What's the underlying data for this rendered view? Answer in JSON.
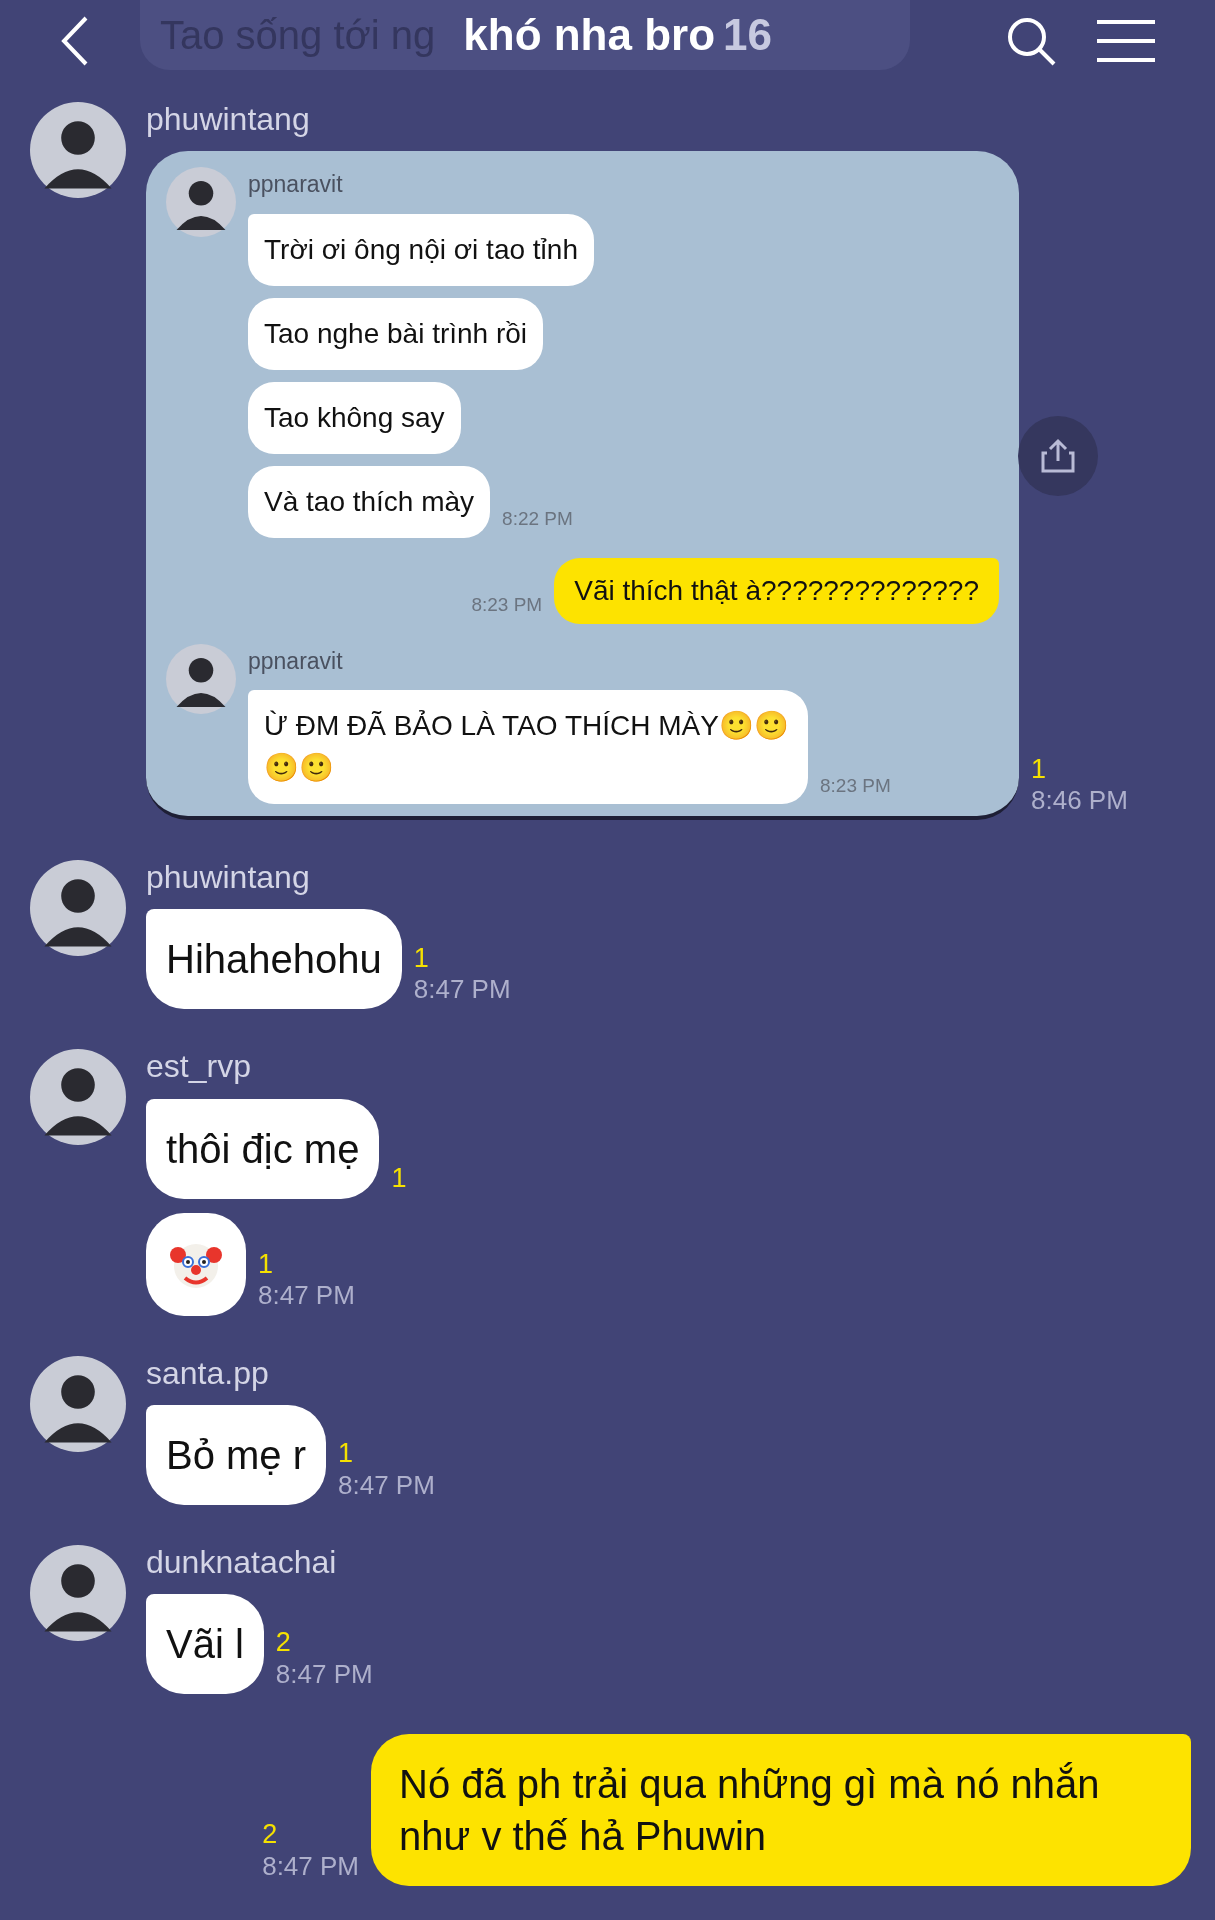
{
  "header": {
    "title": "khó nha bro",
    "member_count": "16",
    "faded_message": "Tao sống tới ng"
  },
  "groups": [
    {
      "sender": "phuwintang",
      "outgoing": false,
      "messages": [
        {
          "kind": "shared_screenshot",
          "read": "1",
          "time": "8:46 PM",
          "screenshot": {
            "items": [
              {
                "kind": "incoming",
                "sender": "ppnaravit",
                "bubbles": [
                  "Trời ơi ông nội ơi tao tỉnh",
                  "Tao nghe bài trình rồi",
                  "Tao không say",
                  "Và tao thích mày"
                ],
                "time": "8:22 PM"
              },
              {
                "kind": "outgoing",
                "bubbles": [
                  "Vãi thích thật à??????????????"
                ],
                "time": "8:23 PM"
              },
              {
                "kind": "incoming",
                "sender": "ppnaravit",
                "bubbles": [
                  "Ừ ĐM ĐÃ BẢO LÀ TAO THÍCH MÀY🙂🙂🙂🙂"
                ],
                "time": "8:23 PM"
              }
            ]
          }
        }
      ]
    },
    {
      "sender": "phuwintang",
      "outgoing": false,
      "messages": [
        {
          "kind": "text",
          "text": "Hihahehohu",
          "read": "1",
          "time": "8:47 PM"
        }
      ]
    },
    {
      "sender": "est_rvp",
      "outgoing": false,
      "messages": [
        {
          "kind": "text",
          "text": "thôi địc mẹ",
          "read": "1"
        },
        {
          "kind": "clown_sticker",
          "read": "1",
          "time": "8:47 PM"
        }
      ]
    },
    {
      "sender": "santa.pp",
      "outgoing": false,
      "messages": [
        {
          "kind": "text",
          "text": "Bỏ mẹ r",
          "read": "1",
          "time": "8:47 PM"
        }
      ]
    },
    {
      "sender": "dunknatachai",
      "outgoing": false,
      "messages": [
        {
          "kind": "text",
          "text": "Vãi l",
          "read": "2",
          "time": "8:47 PM"
        }
      ]
    },
    {
      "outgoing": true,
      "messages": [
        {
          "kind": "text",
          "text": "Nó đã ph trải qua những gì mà nó nhắn như v thế hả Phuwin",
          "read": "2",
          "time": "8:47 PM"
        }
      ]
    }
  ]
}
